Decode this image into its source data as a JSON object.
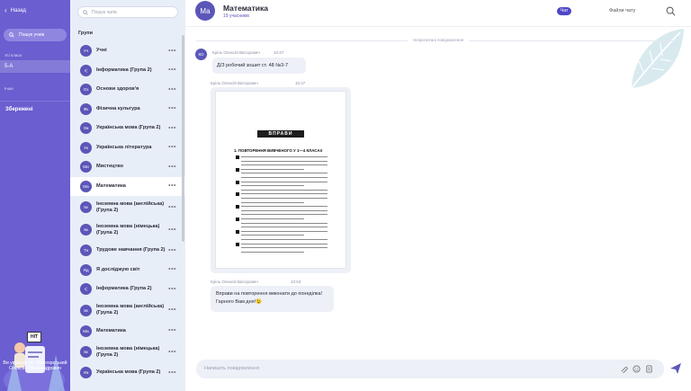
{
  "sidebar": {
    "back_label": "Назад",
    "search_label": "Пошук учнів",
    "classes_label": "Усі класи",
    "class_item": "5-А",
    "other_label": "Інше",
    "saved_label": "Збережені",
    "promo_sign": "НІТ",
    "promo_text": "Ви увійшли як: Монохрєський Олексій Олександрович"
  },
  "chatlist": {
    "search_placeholder": "Пошук чатів",
    "group_title": "Групи",
    "items": [
      {
        "initials": "Уч",
        "name": "Учні"
      },
      {
        "initials": "І(",
        "name": "Інформатика (Група 2)"
      },
      {
        "initials": "Оз",
        "name": "Основи здоров'я"
      },
      {
        "initials": "Фк",
        "name": "Фізична культура"
      },
      {
        "initials": "Ум",
        "name": "Українська мова (Група 2)"
      },
      {
        "initials": "Ук",
        "name": "Українська література"
      },
      {
        "initials": "Ми",
        "name": "Мистецтво"
      },
      {
        "initials": "Ма",
        "name": "Математика"
      },
      {
        "initials": "Ім",
        "name": "Іноземна мова (англійська) (Група 2)"
      },
      {
        "initials": "Ім",
        "name": "Іноземна мова (німецька) (Група 2)"
      },
      {
        "initials": "Тн",
        "name": "Трудове навчання (Група 2)"
      },
      {
        "initials": "Яд",
        "name": "Я досліджую світ"
      },
      {
        "initials": "І(",
        "name": "Інформатика (Група 2)"
      },
      {
        "initials": "Ім",
        "name": "Іноземна мова (англійська) (Група 2)"
      },
      {
        "initials": "Ма",
        "name": "Математика"
      },
      {
        "initials": "Ім",
        "name": "Іноземна мова (німецька) (Група 2)"
      },
      {
        "initials": "Ум",
        "name": "Українська мова (Група 2)"
      }
    ],
    "menu_glyph": "•••"
  },
  "main": {
    "avatar_initials": "Ма",
    "title": "Математика",
    "subtitle": "19 учасників",
    "tab_chat": "Чат",
    "tab_files": "Файли чату",
    "unread_label": "Непрочитані повідомлення",
    "messages": [
      {
        "avatar": "КО",
        "author": "Кріль Олексій Вікторович",
        "time": "10:47",
        "text": "Д/З робочий зошит ст. 48 №3-7"
      },
      {
        "author": "Кріль Олексій Вікторович",
        "time": "10:47",
        "sheet_title": "ВПРАВИ",
        "sheet_subtitle": "1. ПОВТОРЕННЯ ВИВЧЕНОГО У 1—4 КЛАСАХ"
      },
      {
        "author": "Кріль Олексій Вікторович",
        "time": "10:53",
        "line1": "Вправи на повторення виконати до понеділка!",
        "line2": "Гарного Вам дня!😉"
      }
    ],
    "composer_placeholder": "Напишіть повідомлення"
  },
  "icons": {
    "back": "arrow-left-icon",
    "search": "search-icon",
    "menu": "more-horizontal-icon",
    "attach": "paperclip-icon",
    "emoji": "emoji-icon",
    "file": "file-icon",
    "send": "send-icon"
  },
  "colors": {
    "sidebar_bg": "#6a5ed0",
    "list_bg": "#e8eef8",
    "accent": "#4e47c8",
    "avatar": "#5b56b8",
    "bubble": "#edf0f7"
  }
}
